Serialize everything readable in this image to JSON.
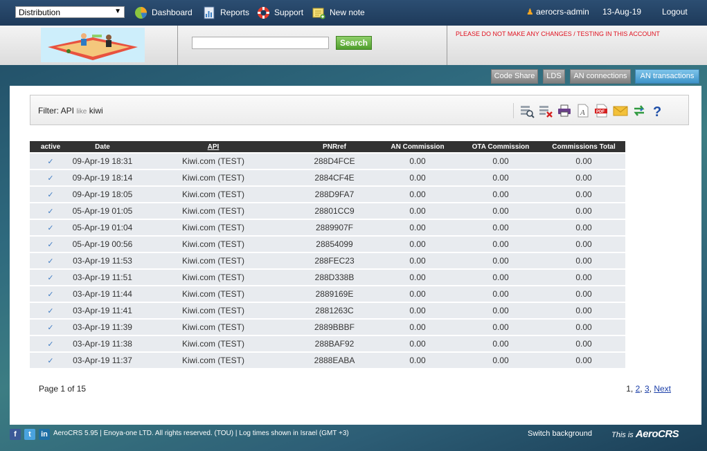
{
  "topbar": {
    "module_select": "Distribution",
    "nav": [
      {
        "label": "Dashboard",
        "icon": "pie-chart-icon"
      },
      {
        "label": "Reports",
        "icon": "report-icon"
      },
      {
        "label": "Support",
        "icon": "lifebuoy-icon"
      },
      {
        "label": "New note",
        "icon": "note-icon"
      }
    ],
    "user": "aerocrs-admin",
    "date": "13-Aug-19",
    "logout": "Logout"
  },
  "header": {
    "search_placeholder": "",
    "search_button": "Search",
    "warning": "PLEASE DO NOT MAKE ANY CHANGES / TESTING IN THIS ACCOUNT"
  },
  "tabs": [
    {
      "label": "Code Share",
      "active": false
    },
    {
      "label": "LDS",
      "active": false
    },
    {
      "label": "AN connections",
      "active": false
    },
    {
      "label": "AN transactions",
      "active": true
    }
  ],
  "filter": {
    "prefix": "Filter: API",
    "operator": "like",
    "value": "kiwi",
    "tools": [
      "search-settings-icon",
      "clear-filter-icon",
      "print-icon",
      "text-export-icon",
      "pdf-icon",
      "email-icon",
      "refresh-icon",
      "help-icon"
    ]
  },
  "table": {
    "headers": [
      "active",
      "Date",
      "API",
      "PNRref",
      "AN Commission",
      "OTA Commission",
      "Commissions Total"
    ],
    "rows": [
      {
        "active": "✓",
        "date": "09-Apr-19 18:31",
        "api": "Kiwi.com (TEST)",
        "pnr": "288D4FCE",
        "an": "0.00",
        "ota": "0.00",
        "total": "0.00"
      },
      {
        "active": "✓",
        "date": "09-Apr-19 18:14",
        "api": "Kiwi.com (TEST)",
        "pnr": "2884CF4E",
        "an": "0.00",
        "ota": "0.00",
        "total": "0.00"
      },
      {
        "active": "✓",
        "date": "09-Apr-19 18:05",
        "api": "Kiwi.com (TEST)",
        "pnr": "288D9FA7",
        "an": "0.00",
        "ota": "0.00",
        "total": "0.00"
      },
      {
        "active": "✓",
        "date": "05-Apr-19 01:05",
        "api": "Kiwi.com (TEST)",
        "pnr": "28801CC9",
        "an": "0.00",
        "ota": "0.00",
        "total": "0.00"
      },
      {
        "active": "✓",
        "date": "05-Apr-19 01:04",
        "api": "Kiwi.com (TEST)",
        "pnr": "2889907F",
        "an": "0.00",
        "ota": "0.00",
        "total": "0.00"
      },
      {
        "active": "✓",
        "date": "05-Apr-19 00:56",
        "api": "Kiwi.com (TEST)",
        "pnr": "28854099",
        "an": "0.00",
        "ota": "0.00",
        "total": "0.00"
      },
      {
        "active": "✓",
        "date": "03-Apr-19 11:53",
        "api": "Kiwi.com (TEST)",
        "pnr": "288FEC23",
        "an": "0.00",
        "ota": "0.00",
        "total": "0.00"
      },
      {
        "active": "✓",
        "date": "03-Apr-19 11:51",
        "api": "Kiwi.com (TEST)",
        "pnr": "288D338B",
        "an": "0.00",
        "ota": "0.00",
        "total": "0.00"
      },
      {
        "active": "✓",
        "date": "03-Apr-19 11:44",
        "api": "Kiwi.com (TEST)",
        "pnr": "2889169E",
        "an": "0.00",
        "ota": "0.00",
        "total": "0.00"
      },
      {
        "active": "✓",
        "date": "03-Apr-19 11:41",
        "api": "Kiwi.com (TEST)",
        "pnr": "2881263C",
        "an": "0.00",
        "ota": "0.00",
        "total": "0.00"
      },
      {
        "active": "✓",
        "date": "03-Apr-19 11:39",
        "api": "Kiwi.com (TEST)",
        "pnr": "2889BBBF",
        "an": "0.00",
        "ota": "0.00",
        "total": "0.00"
      },
      {
        "active": "✓",
        "date": "03-Apr-19 11:38",
        "api": "Kiwi.com (TEST)",
        "pnr": "288BAF92",
        "an": "0.00",
        "ota": "0.00",
        "total": "0.00"
      },
      {
        "active": "✓",
        "date": "03-Apr-19 11:37",
        "api": "Kiwi.com (TEST)",
        "pnr": "2888EABA",
        "an": "0.00",
        "ota": "0.00",
        "total": "0.00"
      }
    ]
  },
  "pagination": {
    "info": "Page 1 of 15",
    "pages": [
      "1",
      "2",
      "3"
    ],
    "next": "Next"
  },
  "footer": {
    "social": [
      "facebook-icon",
      "twitter-icon",
      "linkedin-icon"
    ],
    "text": "AeroCRS 5.95  | Enoya-one LTD. All rights reserved. (TOU)  | Log times shown in Israel (GMT +3)",
    "switch_background": "Switch background",
    "brand_prefix": "This is",
    "brand_name": "AeroCRS"
  },
  "colors": {
    "topbar": "#1e3a5a",
    "warning": "#e0101e",
    "active_tab": "#3d93c9",
    "table_header": "#323232",
    "row_bg": "#e8ebef",
    "link": "#1a3ea8"
  }
}
